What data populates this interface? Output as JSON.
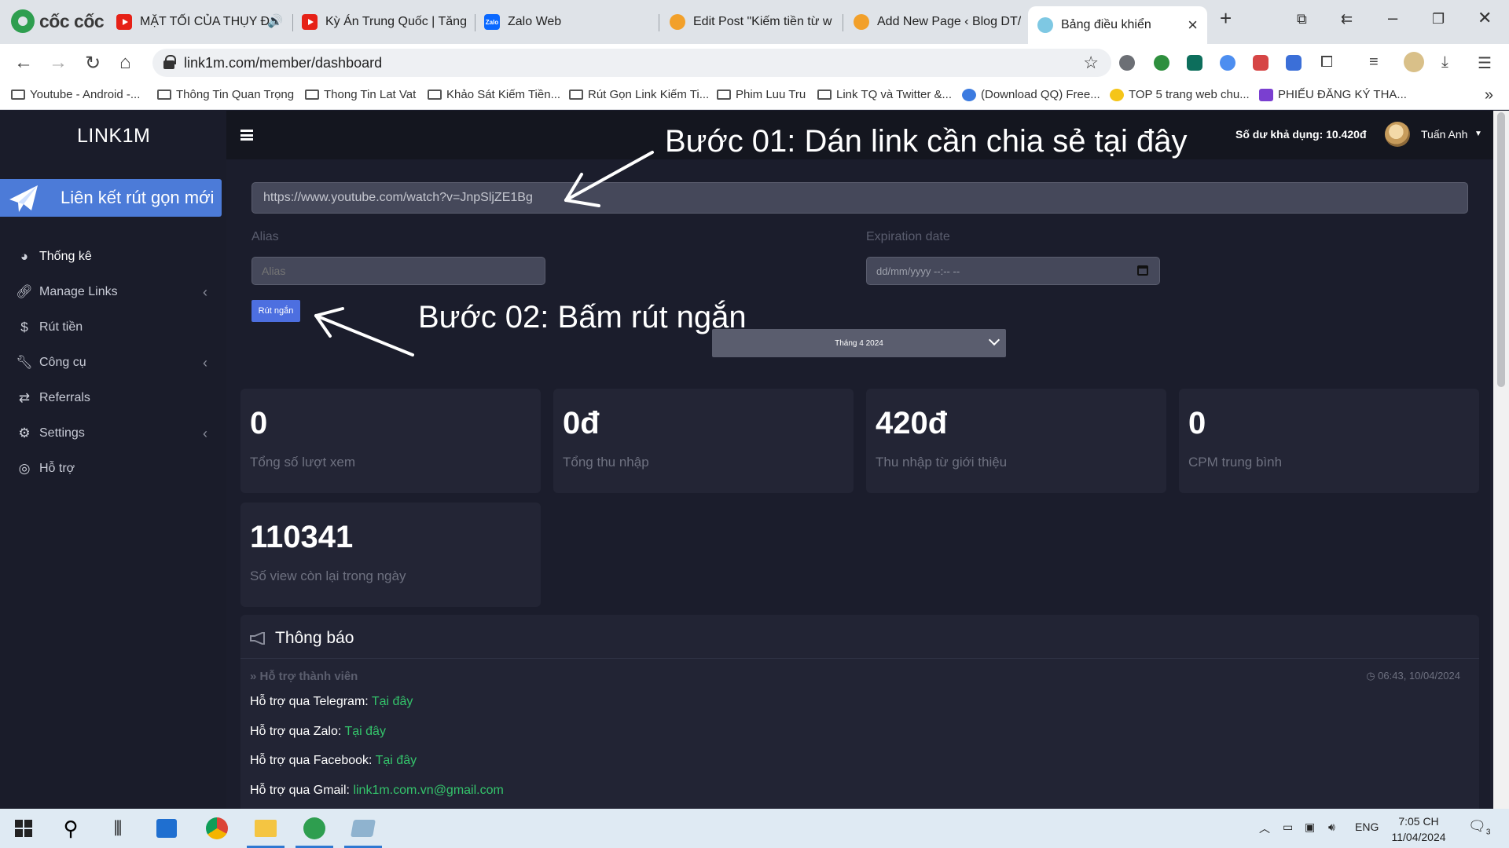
{
  "browser": {
    "brand": "cốc cốc",
    "tabs": [
      {
        "title": "MẶT TỐI CỦA THỤY Đ...",
        "icon": "youtube-icon"
      },
      {
        "title": "Kỳ Án Trung Quốc | Tăng",
        "icon": "youtube-icon"
      },
      {
        "title": "Zalo Web",
        "icon": "zalo-icon"
      },
      {
        "title": "Edit Post \"Kiếm tiền từ w",
        "icon": "emoji-icon"
      },
      {
        "title": "Add New Page ‹ Blog DT/",
        "icon": "emoji-icon"
      },
      {
        "title": "Bảng điều khiển",
        "icon": "dashboard-icon",
        "active": true
      }
    ],
    "url": "link1m.com/member/dashboard",
    "bookmarks": [
      "Youtube - Android -...",
      "Thông Tin Quan Trọng",
      "Thong Tin Lat Vat",
      "Khảo Sát Kiếm Tiền...",
      "Rút Gọn Link Kiếm Ti...",
      "Phim Luu Tru",
      "Link TQ và Twitter &...",
      "(Download QQ) Free...",
      "TOP 5 trang web chu...",
      "PHIẾU ĐĂNG KÝ THA..."
    ]
  },
  "sidebar": {
    "logo": "LINK1M",
    "new_link_label": "Liên kết rút gọn mới",
    "items": [
      {
        "label": "Thống kê",
        "icon": "dashboard-icon"
      },
      {
        "label": "Manage Links",
        "icon": "link-icon"
      },
      {
        "label": "Rút tiền",
        "icon": "dollar-icon"
      },
      {
        "label": "Công cụ",
        "icon": "wrench-icon"
      },
      {
        "label": "Referrals",
        "icon": "exchange-icon"
      },
      {
        "label": "Settings",
        "icon": "gears-icon"
      },
      {
        "label": "Hỗ trợ",
        "icon": "lifebuoy-icon"
      }
    ]
  },
  "header": {
    "balance": "Số dư khả dụng: 10.420đ",
    "username": "Tuấn Anh"
  },
  "form": {
    "url_value": "https://www.youtube.com/watch?v=JnpSljZE1Bg",
    "alias_label": "Alias",
    "alias_placeholder": "Alias",
    "expiration_label": "Expiration date",
    "expiration_placeholder": "dd/mm/yyyy --:-- --",
    "shorten_button": "Rút ngắn",
    "month_selected": "Tháng 4 2024"
  },
  "annotations": {
    "step1": "Bước 01: Dán link cần chia sẻ tại đây",
    "step2": "Bước 02: Bấm rút ngắn"
  },
  "stats": [
    {
      "value": "0",
      "label": "Tổng số lượt xem"
    },
    {
      "value": "0đ",
      "label": "Tổng thu nhập"
    },
    {
      "value": "420đ",
      "label": "Thu nhập từ giới thiệu"
    },
    {
      "value": "0",
      "label": "CPM trung bình"
    },
    {
      "value": "110341",
      "label": "Số view còn lại trong ngày"
    }
  ],
  "notice": {
    "title": "Thông báo",
    "subtitle": "Hỗ trợ thành viên",
    "time": "06:43, 10/04/2024",
    "lines": [
      {
        "label": "Hỗ trợ qua Telegram:",
        "link": "Tại đây"
      },
      {
        "label": "Hỗ trợ qua Zalo:",
        "link": "Tại đây"
      },
      {
        "label": "Hỗ trợ qua Facebook:",
        "link": "Tại đây"
      },
      {
        "label": "Hỗ trợ qua Gmail:",
        "link": "link1m.com.vn@gmail.com"
      }
    ]
  },
  "taskbar": {
    "language": "ENG",
    "time": "7:05 CH",
    "date": "11/04/2024",
    "notifications": "3"
  }
}
